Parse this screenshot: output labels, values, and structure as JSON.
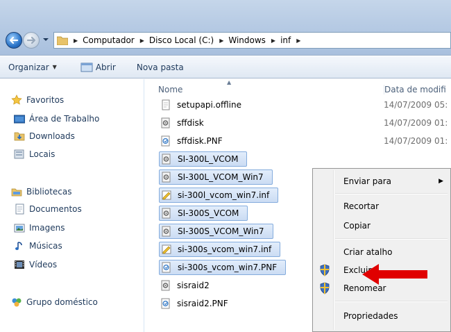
{
  "address_bar": {
    "breadcrumb": [
      "Computador",
      "Disco Local (C:)",
      "Windows",
      "inf"
    ]
  },
  "toolbar": {
    "organizar": "Organizar",
    "abrir": "Abrir",
    "nova_pasta": "Nova pasta"
  },
  "navigation": {
    "favoritos": "Favoritos",
    "area_de_trabalho": "Área de Trabalho",
    "downloads": "Downloads",
    "locais": "Locais",
    "bibliotecas": "Bibliotecas",
    "documentos": "Documentos",
    "imagens": "Imagens",
    "musicas": "Músicas",
    "videos": "Vídeos",
    "grupo_domestico": "Grupo doméstico"
  },
  "columns": {
    "name": "Nome",
    "date": "Data de modifi"
  },
  "files": [
    {
      "name": "setupapi.offline",
      "date": "14/07/2009 05:",
      "icon": "generic-file-icon",
      "selected": false
    },
    {
      "name": "sffdisk",
      "date": "14/07/2009 01:",
      "icon": "config-file-icon",
      "selected": false
    },
    {
      "name": "sffdisk.PNF",
      "date": "14/07/2009 01:",
      "icon": "pnf-file-icon",
      "selected": false
    },
    {
      "name": "SI-300L_VCOM",
      "date": "",
      "icon": "config-file-icon",
      "selected": true
    },
    {
      "name": "SI-300L_VCOM_Win7",
      "date": "",
      "icon": "config-file-icon",
      "selected": true
    },
    {
      "name": "si-300l_vcom_win7.inf",
      "date": "",
      "icon": "inf-file-icon",
      "selected": true
    },
    {
      "name": "SI-300S_VCOM",
      "date": "",
      "icon": "config-file-icon",
      "selected": true
    },
    {
      "name": "SI-300S_VCOM_Win7",
      "date": "",
      "icon": "config-file-icon",
      "selected": true
    },
    {
      "name": "si-300s_vcom_win7.inf",
      "date": "",
      "icon": "inf-file-icon",
      "selected": true
    },
    {
      "name": "si-300s_vcom_win7.PNF",
      "date": "",
      "icon": "pnf-file-icon",
      "selected": true
    },
    {
      "name": "sisraid2",
      "date": "",
      "icon": "config-file-icon",
      "selected": false
    },
    {
      "name": "sisraid2.PNF",
      "date": "",
      "icon": "pnf-file-icon",
      "selected": false
    }
  ],
  "context_menu": {
    "enviar_para": "Enviar para",
    "recortar": "Recortar",
    "copiar": "Copiar",
    "criar_atalho": "Criar atalho",
    "excluir": "Excluir",
    "renomear": "Renomear",
    "propriedades": "Propriedades"
  },
  "colors": {
    "annotation_arrow": "#e00000",
    "selection": "#cbdcf3"
  }
}
